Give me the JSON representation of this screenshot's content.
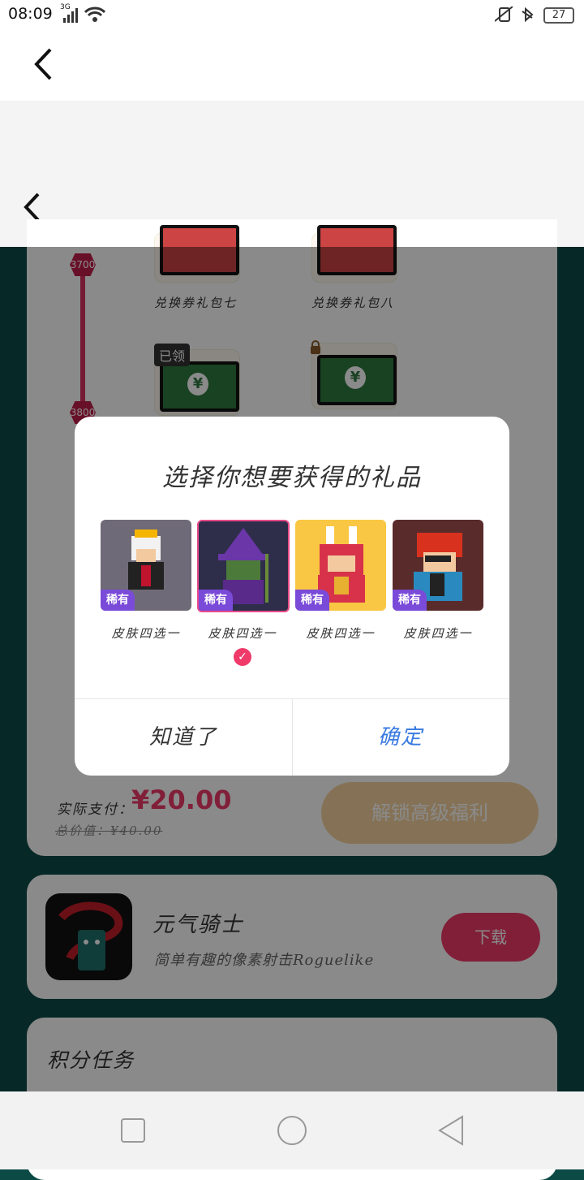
{
  "status_bar": {
    "time": "08:09",
    "network": "3G",
    "battery": "27"
  },
  "reward_section": {
    "milestones": [
      "3700",
      "3800"
    ],
    "gift_labels": [
      "兑换券礼包七",
      "兑换券礼包八"
    ],
    "claimed_badge": "已领",
    "pay_label": "实际支付：",
    "pay_price": "¥20.00",
    "total_label": "总价值：¥40.00",
    "unlock_button": "解锁高级福利"
  },
  "app_card": {
    "name": "元气骑士",
    "desc": "简单有趣的像素射击Roguelike",
    "download_button": "下载"
  },
  "task_card": {
    "title": "积分任务"
  },
  "dialog": {
    "title": "选择你想要获得的礼品",
    "choices": [
      {
        "tag": "稀有",
        "label": "皮肤四选一"
      },
      {
        "tag": "稀有",
        "label": "皮肤四选一"
      },
      {
        "tag": "稀有",
        "label": "皮肤四选一"
      },
      {
        "tag": "稀有",
        "label": "皮肤四选一"
      }
    ],
    "selected_index": 1,
    "cancel_button": "知道了",
    "confirm_button": "确定"
  },
  "colors": {
    "accent": "#ef3a6a",
    "confirm": "#3a7be0",
    "tag": "#7a4ad8",
    "bg": "#0c4a46"
  }
}
